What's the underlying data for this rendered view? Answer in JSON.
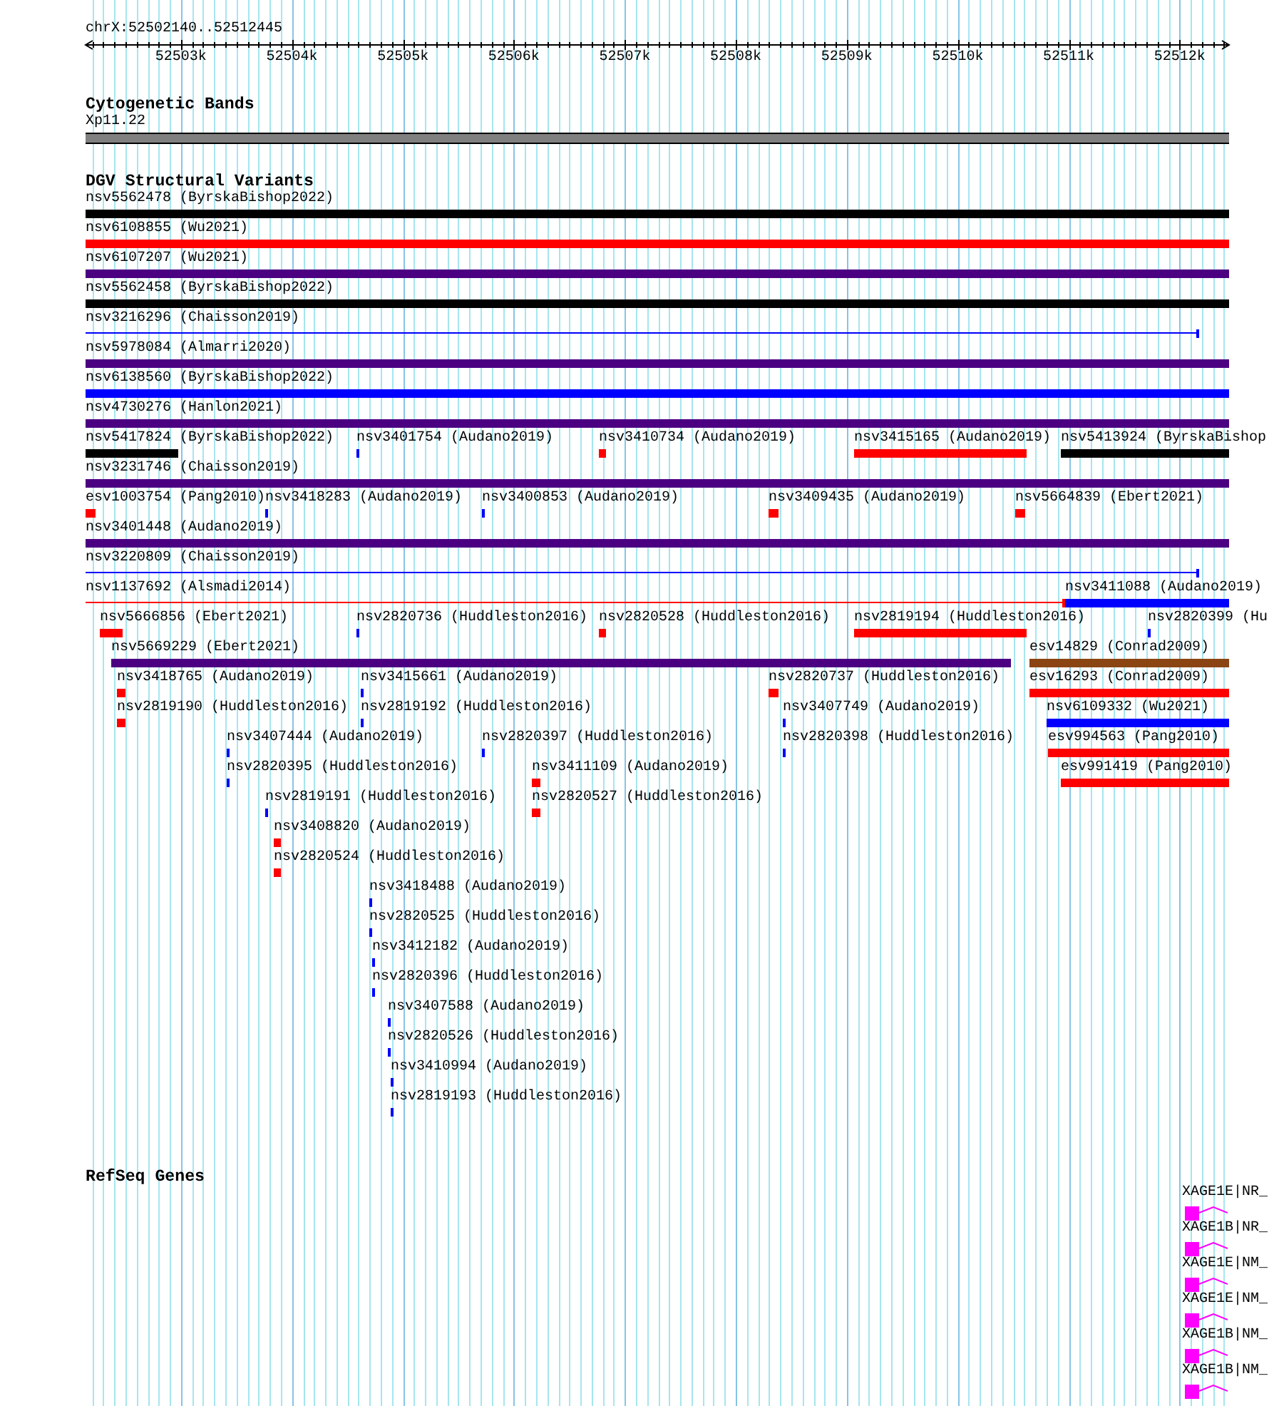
{
  "ruler": {
    "location": "chrX:52502140..52512445",
    "ticks": [
      "52503k",
      "52504k",
      "52505k",
      "52506k",
      "52507k",
      "52508k",
      "52509k",
      "52510k",
      "52511k",
      "52512k"
    ]
  },
  "cytogenetic_bands": {
    "title": "Cytogenetic Bands",
    "bands": [
      {
        "label": "Xp11.22"
      }
    ]
  },
  "structural_variants": {
    "title": "DGV Structural Variants",
    "variants": [
      {
        "label": "nsv5562478 (ByrskaBishop2022)",
        "kind": "bar",
        "color": "#000000"
      },
      {
        "label": "nsv6108855 (Wu2021)",
        "kind": "bar",
        "color": "#ff0000"
      },
      {
        "label": "nsv6107207 (Wu2021)",
        "kind": "bar",
        "color": "#4b0082"
      },
      {
        "label": "nsv5562458 (ByrskaBishop2022)",
        "kind": "bar",
        "color": "#000000"
      },
      {
        "label": "nsv3216296 (Chaisson2019)",
        "kind": "line",
        "color": "#0000ff"
      },
      {
        "label": "nsv5978084 (Almarri2020)",
        "kind": "bar",
        "color": "#4b0082"
      },
      {
        "label": "nsv6138560 (ByrskaBishop2022)",
        "kind": "bar",
        "color": "#0000ff"
      },
      {
        "label": "nsv4730276 (Hanlon2021)",
        "kind": "bar",
        "color": "#4b0082"
      },
      {
        "label": "nsv5417824 (ByrskaBishop2022)",
        "kind": "bar",
        "color": "#000000"
      },
      {
        "label": "nsv3401754 (Audano2019)",
        "kind": "bar",
        "color": "#0000ff"
      },
      {
        "label": "nsv3410734 (Audano2019)",
        "kind": "bar",
        "color": "#ff0000"
      },
      {
        "label": "nsv3415165 (Audano2019)",
        "kind": "bar",
        "color": "#ff0000"
      },
      {
        "label": "nsv5413924 (ByrskaBishop",
        "kind": "bar",
        "color": "#000000"
      },
      {
        "label": "nsv3231746 (Chaisson2019)",
        "kind": "bar",
        "color": "#4b0082"
      },
      {
        "label": "esv1003754 (Pang2010)",
        "kind": "bar",
        "color": "#ff0000"
      },
      {
        "label": "nsv3418283 (Audano2019)",
        "kind": "bar",
        "color": "#0000ff"
      },
      {
        "label": "nsv3400853 (Audano2019)",
        "kind": "bar",
        "color": "#0000ff"
      },
      {
        "label": "nsv3409435 (Audano2019)",
        "kind": "bar",
        "color": "#ff0000"
      },
      {
        "label": "nsv5664839 (Ebert2021)",
        "kind": "bar",
        "color": "#ff0000"
      },
      {
        "label": "nsv3401448 (Audano2019)",
        "kind": "bar",
        "color": "#4b0082"
      },
      {
        "label": "nsv3220809 (Chaisson2019)",
        "kind": "line",
        "color": "#0000ff"
      },
      {
        "label": "nsv1137692 (Alsmadi2014)",
        "kind": "line",
        "color": "#ff0000"
      },
      {
        "label": "nsv3411088 (Audano2019)",
        "kind": "bar",
        "color": "#0000ff"
      },
      {
        "label": "nsv5666856 (Ebert2021)",
        "kind": "bar",
        "color": "#ff0000"
      },
      {
        "label": "nsv2820736 (Huddleston2016)",
        "kind": "bar",
        "color": "#0000ff"
      },
      {
        "label": "nsv2820528 (Huddleston2016)",
        "kind": "bar",
        "color": "#ff0000"
      },
      {
        "label": "nsv2819194 (Huddleston2016)",
        "kind": "bar",
        "color": "#ff0000"
      },
      {
        "label": "nsv2820399 (Hu",
        "kind": "bar",
        "color": "#0000ff"
      },
      {
        "label": "nsv5669229 (Ebert2021)",
        "kind": "bar",
        "color": "#4b0082"
      },
      {
        "label": "esv14829 (Conrad2009)",
        "kind": "bar",
        "color": "#8b4513"
      },
      {
        "label": "nsv3418765 (Audano2019)",
        "kind": "bar",
        "color": "#ff0000"
      },
      {
        "label": "nsv3415661 (Audano2019)",
        "kind": "bar",
        "color": "#0000ff"
      },
      {
        "label": "nsv2820737 (Huddleston2016)",
        "kind": "bar",
        "color": "#ff0000"
      },
      {
        "label": "esv16293 (Conrad2009)",
        "kind": "bar",
        "color": "#ff0000"
      },
      {
        "label": "nsv2819190 (Huddleston2016)",
        "kind": "bar",
        "color": "#ff0000"
      },
      {
        "label": "nsv2819192 (Huddleston2016)",
        "kind": "bar",
        "color": "#0000ff"
      },
      {
        "label": "nsv3407749 (Audano2019)",
        "kind": "bar",
        "color": "#0000ff"
      },
      {
        "label": "nsv6109332 (Wu2021)",
        "kind": "bar",
        "color": "#0000ff"
      },
      {
        "label": "nsv3407444 (Audano2019)",
        "kind": "bar",
        "color": "#0000ff"
      },
      {
        "label": "nsv2820397 (Huddleston2016)",
        "kind": "bar",
        "color": "#0000ff"
      },
      {
        "label": "nsv2820398 (Huddleston2016)",
        "kind": "bar",
        "color": "#0000ff"
      },
      {
        "label": "esv994563 (Pang2010)",
        "kind": "bar",
        "color": "#ff0000"
      },
      {
        "label": "nsv2820395 (Huddleston2016)",
        "kind": "bar",
        "color": "#0000ff"
      },
      {
        "label": "nsv3411109 (Audano2019)",
        "kind": "bar",
        "color": "#ff0000"
      },
      {
        "label": "esv991419 (Pang2010)",
        "kind": "bar",
        "color": "#ff0000"
      },
      {
        "label": "nsv2819191 (Huddleston2016)",
        "kind": "bar",
        "color": "#0000ff"
      },
      {
        "label": "nsv2820527 (Huddleston2016)",
        "kind": "bar",
        "color": "#ff0000"
      },
      {
        "label": "nsv3408820 (Audano2019)",
        "kind": "bar",
        "color": "#ff0000"
      },
      {
        "label": "nsv2820524 (Huddleston2016)",
        "kind": "bar",
        "color": "#ff0000"
      },
      {
        "label": "nsv3418488 (Audano2019)",
        "kind": "bar",
        "color": "#0000ff"
      },
      {
        "label": "nsv2820525 (Huddleston2016)",
        "kind": "bar",
        "color": "#0000ff"
      },
      {
        "label": "nsv3412182 (Audano2019)",
        "kind": "bar",
        "color": "#0000ff"
      },
      {
        "label": "nsv2820396 (Huddleston2016)",
        "kind": "bar",
        "color": "#0000ff"
      },
      {
        "label": "nsv3407588 (Audano2019)",
        "kind": "bar",
        "color": "#0000ff"
      },
      {
        "label": "nsv2820526 (Huddleston2016)",
        "kind": "bar",
        "color": "#0000ff"
      },
      {
        "label": "nsv3410994 (Audano2019)",
        "kind": "bar",
        "color": "#0000ff"
      },
      {
        "label": "nsv2819193 (Huddleston2016)",
        "kind": "bar",
        "color": "#0000ff"
      }
    ]
  },
  "refseq_genes": {
    "title": "RefSeq Genes",
    "genes": [
      {
        "label": "XAGE1E|NR_"
      },
      {
        "label": "XAGE1B|NR_"
      },
      {
        "label": "XAGE1E|NM_"
      },
      {
        "label": "XAGE1E|NM_"
      },
      {
        "label": "XAGE1B|NM_"
      },
      {
        "label": "XAGE1B|NM_"
      }
    ]
  }
}
